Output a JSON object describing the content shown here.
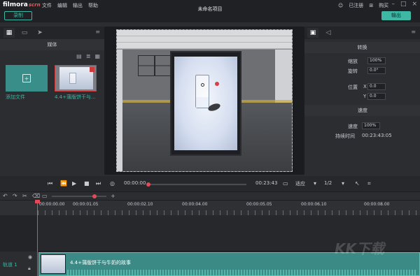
{
  "app": {
    "logo": "filmora",
    "logo_sub": "scrn",
    "window_title": "未命名项目",
    "menu": [
      "文件",
      "编辑",
      "输出",
      "帮助"
    ],
    "login": "已注册",
    "buy": "购买",
    "record_label": "录制",
    "export_label": "输出"
  },
  "left_panel": {
    "header": "媒体",
    "add_file_label": "添加文件",
    "clip_label": "4.4+蒲版饼干与...",
    "tabs": [
      "media-tab-icon",
      "chat-tab-icon",
      "cursor-tab-icon"
    ]
  },
  "right_panel": {
    "transform_header": "转换",
    "scale_label": "缩放",
    "scale_value": "100%",
    "rotate_label": "旋转",
    "rotate_value": "0.0°",
    "position_label": "位置",
    "x_label": "X",
    "x_value": "0.0",
    "y_label": "Y",
    "y_value": "0.0",
    "speed_header": "速度",
    "speed_label": "速度",
    "speed_value": "100%",
    "duration_label": "持续时间",
    "duration_value": "00:23:43:05"
  },
  "playback": {
    "current_time": "00:00:00",
    "total_time": "00:23:43",
    "fit_label": "适应",
    "quality_label": "1/2",
    "progress": 0.0
  },
  "timeline": {
    "ruler_start": "00:00:00.00",
    "ruler_marks": [
      "00:00:00.00",
      "00:00:01.05",
      "00:00:02.10",
      "00:00:04.00",
      "00:00:05.05",
      "00:00:06.10",
      "00:00:08.00"
    ],
    "track_name": "轨道 1",
    "clip_title": "4.4+蒲版饼干与牛奶的故事",
    "zoom_level": 0.78
  },
  "watermark": "KK下载"
}
